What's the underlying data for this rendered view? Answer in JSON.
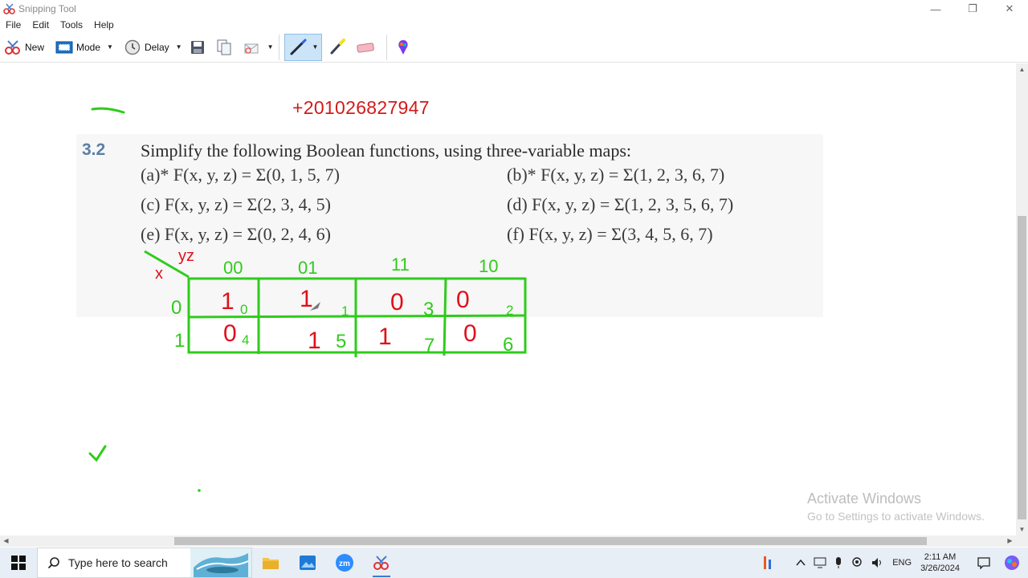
{
  "window": {
    "title": "Snipping Tool",
    "minimize": "—",
    "restore": "❐",
    "close": "✕"
  },
  "menu": [
    "File",
    "Edit",
    "Tools",
    "Help"
  ],
  "toolbar": {
    "new_label": "New",
    "mode_label": "Mode",
    "delay_label": "Delay"
  },
  "content": {
    "phone": "+201026827947",
    "problem_number": "3.2",
    "problem_title": "Simplify the following Boolean functions, using three-variable maps:",
    "items": [
      "(a)* F(x, y, z) = Σ(0, 1, 5, 7)",
      "(b)* F(x, y, z) = Σ(1, 2, 3, 6, 7)",
      "(c)  F(x, y, z) = Σ(2, 3, 4, 5)",
      "(d)  F(x, y, z) = Σ(1, 2, 3, 5, 6, 7)",
      "(e)  F(x, y, z) = Σ(0, 2, 4, 6)",
      "(f)  F(x, y, z) = Σ(3, 4, 5, 6, 7)"
    ],
    "kmap": {
      "row_var": "x",
      "col_var": "yz",
      "col_headers": [
        "00",
        "01",
        "11",
        "10"
      ],
      "row_headers": [
        "0",
        "1"
      ],
      "values": [
        [
          "1",
          "1",
          "0",
          "0"
        ],
        [
          "0",
          "1",
          "1",
          "0"
        ]
      ],
      "minterms": [
        [
          "0",
          "1",
          "3",
          "2"
        ],
        [
          "4",
          "5",
          "7",
          "6"
        ]
      ]
    }
  },
  "watermark": {
    "line1": "Activate Windows",
    "line2": "Go to Settings to activate Windows."
  },
  "taskbar": {
    "search_placeholder": "Type here to search",
    "language": "ENG",
    "time": "2:11 AM",
    "date": "3/26/2024"
  },
  "colors": {
    "ink_green": "#2ecc1a",
    "ink_red": "#e0101a",
    "phone_red": "#d21a1a",
    "accent_blue": "#3a7bd5"
  }
}
